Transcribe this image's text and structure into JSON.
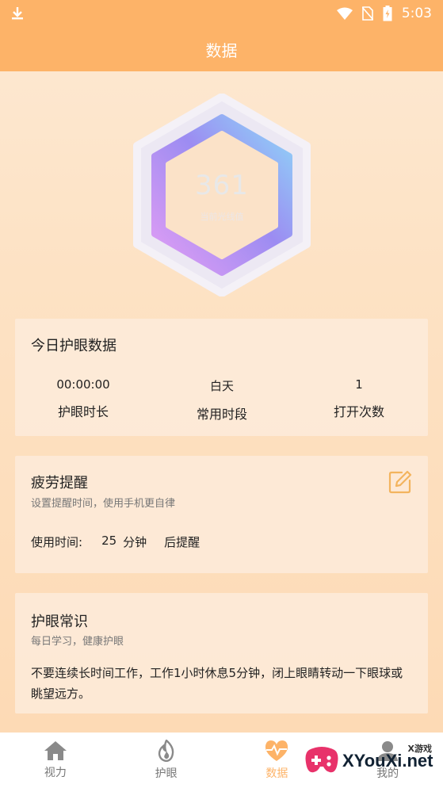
{
  "status_bar": {
    "time": "5:03"
  },
  "header": {
    "title": "数据"
  },
  "gauge": {
    "value": "361",
    "label": "当前光线值"
  },
  "today": {
    "title": "今日护眼数据",
    "stats": [
      {
        "value": "00:00:00",
        "label": "护眼时长"
      },
      {
        "value": "白天",
        "label": "常用时段"
      },
      {
        "value": "1",
        "label": "打开次数"
      }
    ]
  },
  "fatigue": {
    "title": "疲劳提醒",
    "subtitle": "设置提醒时间，使用手机更自律",
    "usage_label": "使用时间:",
    "minutes": "25",
    "minutes_unit": "分钟",
    "after_label": "后提醒"
  },
  "knowledge": {
    "title": "护眼常识",
    "subtitle": "每日学习，健康护眼",
    "text": "不要连续长时间工作，工作1小时休息5分钟，闭上眼睛转动一下眼球或眺望远方。"
  },
  "nav": {
    "items": [
      {
        "label": "视力",
        "icon": "home-icon"
      },
      {
        "label": "护眼",
        "icon": "fire-icon"
      },
      {
        "label": "数据",
        "icon": "heart-pulse-icon"
      },
      {
        "label": "我的",
        "icon": "user-icon"
      }
    ],
    "active_index": 2
  },
  "watermark": {
    "text": "XYouXi.net",
    "small": "X游戏"
  },
  "colors": {
    "accent": "#fdb368",
    "background": "#fde2c4"
  }
}
